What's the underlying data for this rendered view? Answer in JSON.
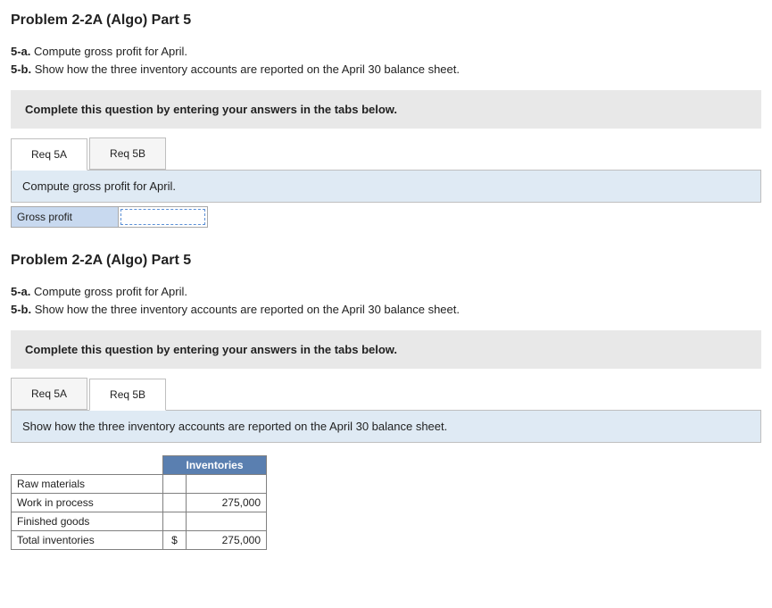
{
  "section1": {
    "title": "Problem 2-2A (Algo) Part 5",
    "prompts": {
      "a_label": "5-a.",
      "a_text": "Compute gross profit for April.",
      "b_label": "5-b.",
      "b_text": "Show how the three inventory accounts are reported on the April 30 balance sheet."
    },
    "box": "Complete this question by entering your answers in the tabs below.",
    "tabs": {
      "a": "Req 5A",
      "b": "Req 5B"
    },
    "banner": "Compute gross profit for April.",
    "gross_profit_label": "Gross profit",
    "gross_profit_value": ""
  },
  "section2": {
    "title": "Problem 2-2A (Algo) Part 5",
    "prompts": {
      "a_label": "5-a.",
      "a_text": "Compute gross profit for April.",
      "b_label": "5-b.",
      "b_text": "Show how the three inventory accounts are reported on the April 30 balance sheet."
    },
    "box": "Complete this question by entering your answers in the tabs below.",
    "tabs": {
      "a": "Req 5A",
      "b": "Req 5B"
    },
    "banner": "Show how the three inventory accounts are reported on the April 30 balance sheet.",
    "inv_header": "Inventories",
    "rows": {
      "raw": {
        "label": "Raw materials",
        "currency": "",
        "value": ""
      },
      "wip": {
        "label": "Work in process",
        "currency": "",
        "value": "275,000"
      },
      "fg": {
        "label": "Finished goods",
        "currency": "",
        "value": ""
      },
      "total": {
        "label": "Total inventories",
        "currency": "$",
        "value": "275,000"
      }
    }
  }
}
